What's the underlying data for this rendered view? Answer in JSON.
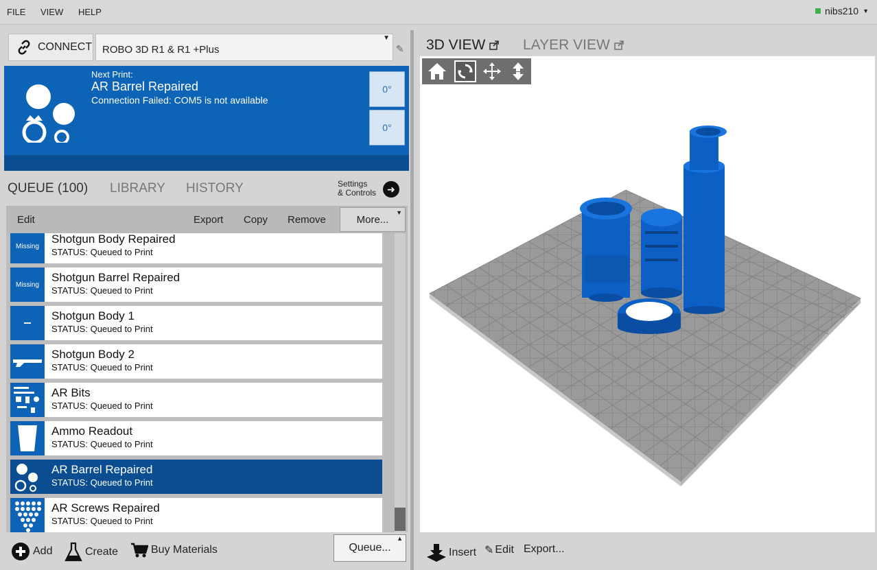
{
  "menu": {
    "file": "FILE",
    "view": "VIEW",
    "help": "HELP"
  },
  "user": {
    "name": "nibs210"
  },
  "connection": {
    "connect_label": "CONNECT",
    "printer": "ROBO 3D R1 & R1 +Plus"
  },
  "status": {
    "next_label": "Next Print:",
    "next_name": "AR Barrel Repaired",
    "message": "Connection Failed: COM5 is not available",
    "temp1": "0°",
    "temp2": "0°"
  },
  "tabs": {
    "queue": "QUEUE (100)",
    "library": "LIBRARY",
    "history": "HISTORY",
    "settings_line1": "Settings",
    "settings_line2": "& Controls"
  },
  "toolbar": {
    "edit": "Edit",
    "export": "Export",
    "copy": "Copy",
    "remove": "Remove",
    "more": "More..."
  },
  "queue_items": [
    {
      "name": "Shotgun Body Repaired",
      "status": "STATUS: Queued to Print",
      "thumb": "Missing"
    },
    {
      "name": "Shotgun Barrel Repaired",
      "status": "STATUS: Queued to Print",
      "thumb": "Missing"
    },
    {
      "name": "Shotgun Body 1",
      "status": "STATUS: Queued to Print",
      "thumb": ""
    },
    {
      "name": "Shotgun Body 2",
      "status": "STATUS: Queued to Print",
      "thumb": ""
    },
    {
      "name": "AR Bits",
      "status": "STATUS: Queued to Print",
      "thumb": ""
    },
    {
      "name": "Ammo Readout",
      "status": "STATUS: Queued to Print",
      "thumb": ""
    },
    {
      "name": "AR Barrel Repaired",
      "status": "STATUS: Queued to Print",
      "thumb": ""
    },
    {
      "name": "AR Screws Repaired",
      "status": "STATUS: Queued to Print",
      "thumb": ""
    }
  ],
  "bottom": {
    "add": "Add",
    "create": "Create",
    "buy": "Buy Materials",
    "queue": "Queue..."
  },
  "view_tabs": {
    "view3d": "3D VIEW",
    "layer": "LAYER VIEW"
  },
  "right_bottom": {
    "insert": "Insert",
    "edit": "Edit",
    "export": "Export..."
  },
  "colors": {
    "accent_blue": "#0d63b5",
    "selected_blue": "#0a4e91",
    "model_blue": "#0c5fc4",
    "bed_gray": "#9a9a9a"
  }
}
